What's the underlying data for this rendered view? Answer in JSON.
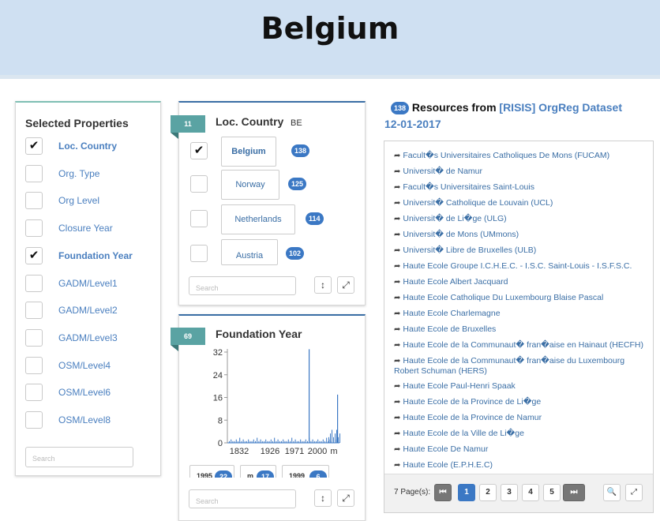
{
  "header": {
    "title": "Belgium"
  },
  "props": {
    "title": "Selected Properties",
    "items": [
      {
        "label": "Loc. Country",
        "checked": true
      },
      {
        "label": "Org. Type",
        "checked": false
      },
      {
        "label": "Org Level",
        "checked": false
      },
      {
        "label": "Closure Year",
        "checked": false
      },
      {
        "label": "Foundation Year",
        "checked": true
      },
      {
        "label": "GADM/Level1",
        "checked": false
      },
      {
        "label": "GADM/Level2",
        "checked": false
      },
      {
        "label": "GADM/Level3",
        "checked": false
      },
      {
        "label": "OSM/Level4",
        "checked": false
      },
      {
        "label": "OSM/Level6",
        "checked": false
      },
      {
        "label": "OSM/Level8",
        "checked": false
      }
    ],
    "search_placeholder": "Search",
    "check_glyph": "✔"
  },
  "country": {
    "count": "11",
    "title": "Loc. Country",
    "filter": "BE",
    "values": [
      {
        "label": "Belgium",
        "count": "138",
        "checked": true
      },
      {
        "label": "Norway",
        "count": "125",
        "checked": false
      },
      {
        "label": "Netherlands",
        "count": "114",
        "checked": false
      },
      {
        "label": "Austria",
        "count": "102",
        "checked": false
      }
    ],
    "search_placeholder": "Search",
    "sort_icon": "↕",
    "expand_icon": "⤢"
  },
  "foundation": {
    "count": "69",
    "title": "Foundation Year",
    "buttons": [
      {
        "label": "1995",
        "count": "22"
      },
      {
        "label": "m",
        "count": "17"
      },
      {
        "label": "1999",
        "count": "6"
      }
    ],
    "search_placeholder": "Search",
    "sort_icon": "↕",
    "expand_icon": "⤢"
  },
  "chart_data": {
    "type": "bar",
    "x_tick_labels": [
      "1832",
      "1926",
      "1971",
      "2000",
      "m"
    ],
    "y_ticks": [
      0,
      8,
      16,
      24,
      32
    ],
    "ylim": [
      0,
      32
    ],
    "color": "#3b78c4",
    "spikes": [
      {
        "label": "2000",
        "value": 33
      },
      {
        "label": "m",
        "value": 17
      }
    ]
  },
  "resources": {
    "count": "138",
    "title": "Resources from",
    "source": "[RISIS] OrgReg Dataset",
    "date": "12-01-2017",
    "items": [
      "Facult�s Universitaires Catholiques De Mons (FUCAM)",
      "Universit� de Namur",
      "Facult�s Universitaires Saint-Louis",
      "Universit� Catholique de Louvain (UCL)",
      "Universit� de Li�ge (ULG)",
      "Universit� de Mons (UMmons)",
      "Universit� Libre de Bruxelles (ULB)",
      "Haute Ecole Groupe I.C.H.E.C. - I.S.C. Saint-Louis - I.S.F.S.C.",
      "Haute Ecole Albert Jacquard",
      "Haute Ecole Catholique Du Luxembourg Blaise Pascal",
      "Haute Ecole Charlemagne",
      "Haute Ecole de Bruxelles",
      "Haute Ecole de la Communaut� fran�aise en Hainaut (HECFH)",
      "Haute Ecole de la Communaut� fran�aise du Luxembourg Robert Schuman (HERS)",
      "Haute Ecole Paul-Henri Spaak",
      "Haute Ecole de la Province de Li�ge",
      "Haute Ecole de la Province de Namur",
      "Haute Ecole de la Ville de Li�ge",
      "Haute Ecole De Namur",
      "Haute Ecole (E.P.H.E.C)"
    ],
    "pages_label": "7 Page(s):",
    "first_icon": "⏮",
    "last_icon": "⏭",
    "pages": [
      "1",
      "2",
      "3",
      "4",
      "5"
    ],
    "link_icon": "🔗",
    "search_icon": "🔍",
    "expand_icon": "⤢"
  }
}
